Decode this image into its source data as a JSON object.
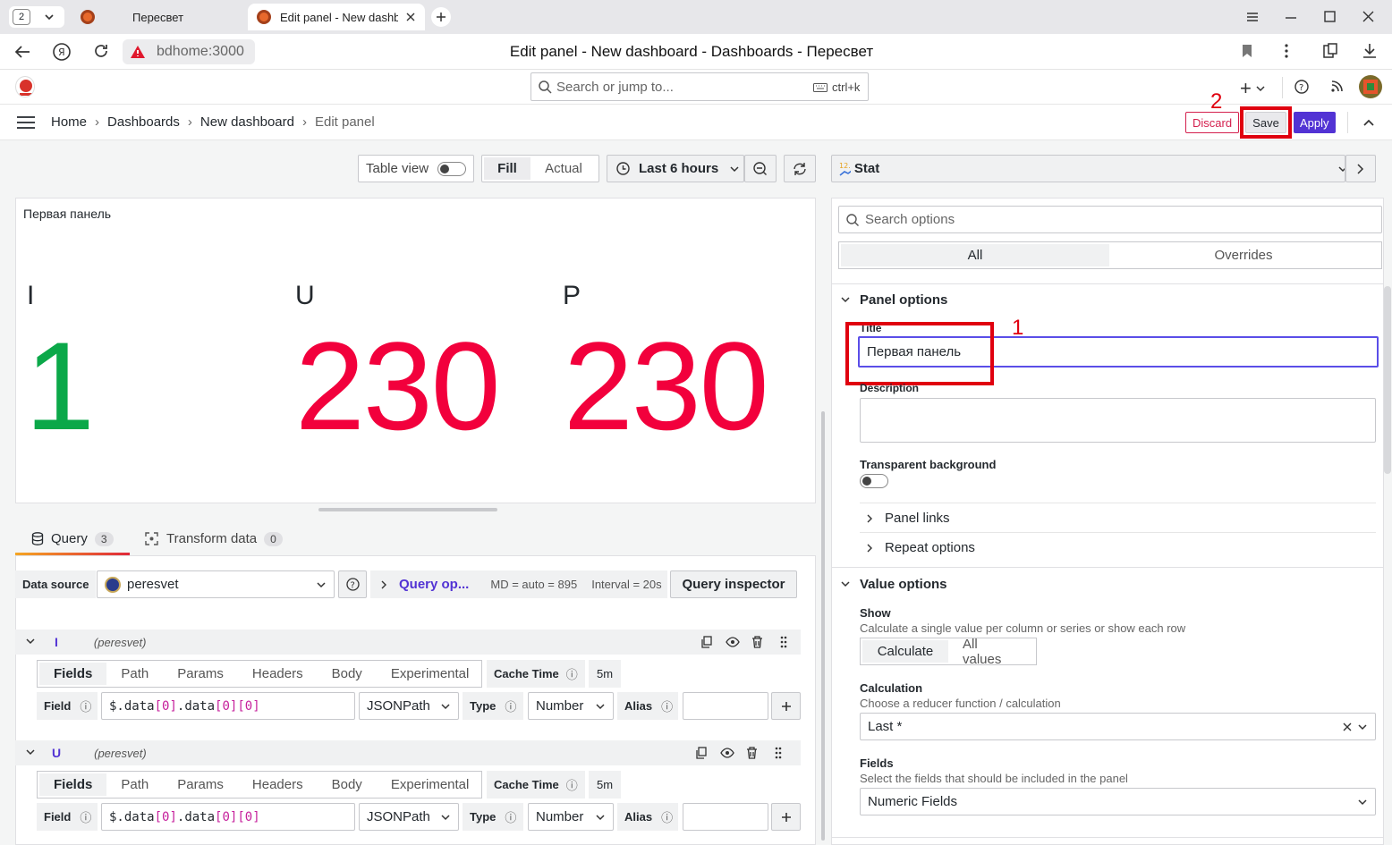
{
  "browser": {
    "tab_count": "2",
    "tabs": [
      {
        "title": "Пересвет"
      },
      {
        "title": "Edit panel - New dashb..."
      }
    ],
    "address": "bdhome:3000",
    "window_title": "Edit panel - New dashboard - Dashboards - Пересвет"
  },
  "topbar": {
    "search_placeholder": "Search or jump to...",
    "shortcut": "ctrl+k",
    "new_label": "+"
  },
  "breadcrumb": [
    "Home",
    "Dashboards",
    "New dashboard",
    "Edit panel"
  ],
  "actions": {
    "discard": "Discard",
    "save": "Save",
    "apply": "Apply"
  },
  "toolbar": {
    "table_view": "Table view",
    "fill": "Fill",
    "actual": "Actual",
    "time_range": "Last 6 hours",
    "viz": "Stat"
  },
  "panel": {
    "title": "Первая панель",
    "stats": [
      {
        "label": "I",
        "value": "1",
        "color": "#0ba849"
      },
      {
        "label": "U",
        "value": "230",
        "color": "#f2003c"
      },
      {
        "label": "P",
        "value": "230",
        "color": "#f2003c"
      }
    ]
  },
  "query": {
    "tabs": [
      {
        "label": "Query",
        "count": "3"
      },
      {
        "label": "Transform data",
        "count": "0"
      }
    ],
    "datasource_label": "Data source",
    "datasource": "peresvet",
    "query_options": "Query op...",
    "md": "MD = auto = 895",
    "interval": "Interval = 20s",
    "inspector": "Query inspector",
    "rows": [
      {
        "name": "I",
        "source": "(peresvet)"
      },
      {
        "name": "U",
        "source": "(peresvet)"
      }
    ],
    "subtabs": [
      "Fields",
      "Path",
      "Params",
      "Headers",
      "Body",
      "Experimental"
    ],
    "cache_time_label": "Cache Time",
    "cache_time": "5m",
    "field_label": "Field",
    "field_value": "$.data[0].data[0][0]",
    "jsonpath": "JSONPath",
    "type_label": "Type",
    "type_value": "Number",
    "alias_label": "Alias"
  },
  "options": {
    "search_placeholder": "Search options",
    "tabs": [
      "All",
      "Overrides"
    ],
    "panel_options": "Panel options",
    "title_label": "Title",
    "title_value": "Первая панель",
    "description_label": "Description",
    "transparent_label": "Transparent background",
    "panel_links": "Panel links",
    "repeat_options": "Repeat options",
    "value_options": "Value options",
    "show_label": "Show",
    "show_desc": "Calculate a single value per column or series or show each row",
    "show_options": [
      "Calculate",
      "All values"
    ],
    "calc_label": "Calculation",
    "calc_desc": "Choose a reducer function / calculation",
    "calc_value": "Last *",
    "fields_label": "Fields",
    "fields_desc": "Select the fields that should be included in the panel",
    "fields_value": "Numeric Fields"
  },
  "annotations": {
    "one": "1",
    "two": "2"
  }
}
